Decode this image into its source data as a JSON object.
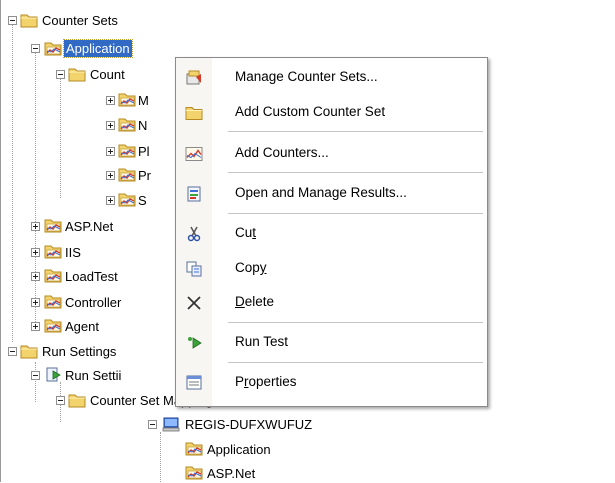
{
  "tree": {
    "counter_sets": "Counter Sets",
    "application": "Application",
    "counter_categories_partial": "Count",
    "sub_m": "M",
    "sub_n": "N",
    "sub_p1": "Pl",
    "sub_p2": "Pr",
    "sub_s": "S",
    "asp_net": "ASP.Net",
    "iis": "IIS",
    "loadtest": "LoadTest",
    "controller": "Controller",
    "agent": "Agent",
    "run_settings": "Run Settings",
    "run_settings_child_partial": "Run Settii",
    "counter_set_mappings_partial": "Counter Set Mappings",
    "machine": "REGIS-DUFXWUFUZ",
    "map_application": "Application",
    "map_asp_net": "ASP.Net"
  },
  "menu": {
    "items": [
      {
        "label": "Manage Counter Sets...",
        "icon": "manage-counter-sets-icon"
      },
      {
        "label": "Add Custom Counter Set",
        "icon": "add-custom-counter-set-icon"
      },
      {
        "label": "Add Counters...",
        "icon": "add-counters-icon"
      },
      {
        "label": "Open and Manage Results...",
        "icon": "open-results-icon"
      },
      {
        "label_pre": "Cu",
        "label_u": "t",
        "label_post": "",
        "icon": "scissors-icon"
      },
      {
        "label_pre": "Cop",
        "label_u": "y",
        "label_post": "",
        "icon": "copy-icon"
      },
      {
        "label_pre": "",
        "label_u": "D",
        "label_post": "elete",
        "icon": "delete-x-icon"
      },
      {
        "label": "Run Test",
        "icon": "run-test-icon"
      },
      {
        "label_pre": "P",
        "label_u": "r",
        "label_post": "operties",
        "icon": "properties-icon"
      }
    ]
  },
  "colors": {
    "selection": "#316ac5",
    "folder": "#f3d36b",
    "menu_gutter": "#f7f6f3"
  }
}
